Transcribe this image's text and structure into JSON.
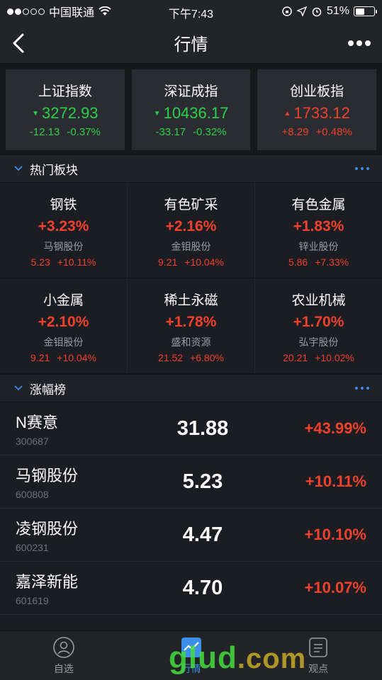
{
  "status": {
    "carrier": "中国联通",
    "time": "下午7:43",
    "battery": "51%"
  },
  "nav": {
    "title": "行情"
  },
  "indices": [
    {
      "name": "上证指数",
      "value": "3272.93",
      "change": "-12.13",
      "pct": "-0.37%",
      "dir": "down"
    },
    {
      "name": "深证成指",
      "value": "10436.17",
      "change": "-33.17",
      "pct": "-0.32%",
      "dir": "down"
    },
    {
      "name": "创业板指",
      "value": "1733.12",
      "change": "+8.29",
      "pct": "+0.48%",
      "dir": "up"
    }
  ],
  "hot_sectors": {
    "title": "热门板块",
    "items": [
      {
        "name": "钢铁",
        "pct": "+3.23%",
        "stock": "马钢股份",
        "price": "5.23",
        "stock_pct": "+10.11%"
      },
      {
        "name": "有色矿采",
        "pct": "+2.16%",
        "stock": "金钼股份",
        "price": "9.21",
        "stock_pct": "+10.04%"
      },
      {
        "name": "有色金属",
        "pct": "+1.83%",
        "stock": "锌业股份",
        "price": "5.86",
        "stock_pct": "+7.33%"
      },
      {
        "name": "小金属",
        "pct": "+2.10%",
        "stock": "金钼股份",
        "price": "9.21",
        "stock_pct": "+10.04%"
      },
      {
        "name": "稀土永磁",
        "pct": "+1.78%",
        "stock": "盛和资源",
        "price": "21.52",
        "stock_pct": "+6.80%"
      },
      {
        "name": "农业机械",
        "pct": "+1.70%",
        "stock": "弘宇股份",
        "price": "20.21",
        "stock_pct": "+10.02%"
      }
    ]
  },
  "gainers": {
    "title": "涨幅榜",
    "rows": [
      {
        "name": "N赛意",
        "code": "300687",
        "price": "31.88",
        "pct": "+43.99%"
      },
      {
        "name": "马钢股份",
        "code": "600808",
        "price": "5.23",
        "pct": "+10.11%"
      },
      {
        "name": "凌钢股份",
        "code": "600231",
        "price": "4.47",
        "pct": "+10.10%"
      },
      {
        "name": "嘉泽新能",
        "code": "601619",
        "price": "4.70",
        "pct": "+10.07%"
      }
    ]
  },
  "tabs": [
    {
      "label": "自选"
    },
    {
      "label": "行情"
    },
    {
      "label": "观点"
    }
  ],
  "watermark": {
    "brand": "glud",
    "domain": ".com"
  },
  "colors": {
    "up": "#f0412d",
    "down": "#2fd04a",
    "accent": "#3b8fe8"
  }
}
